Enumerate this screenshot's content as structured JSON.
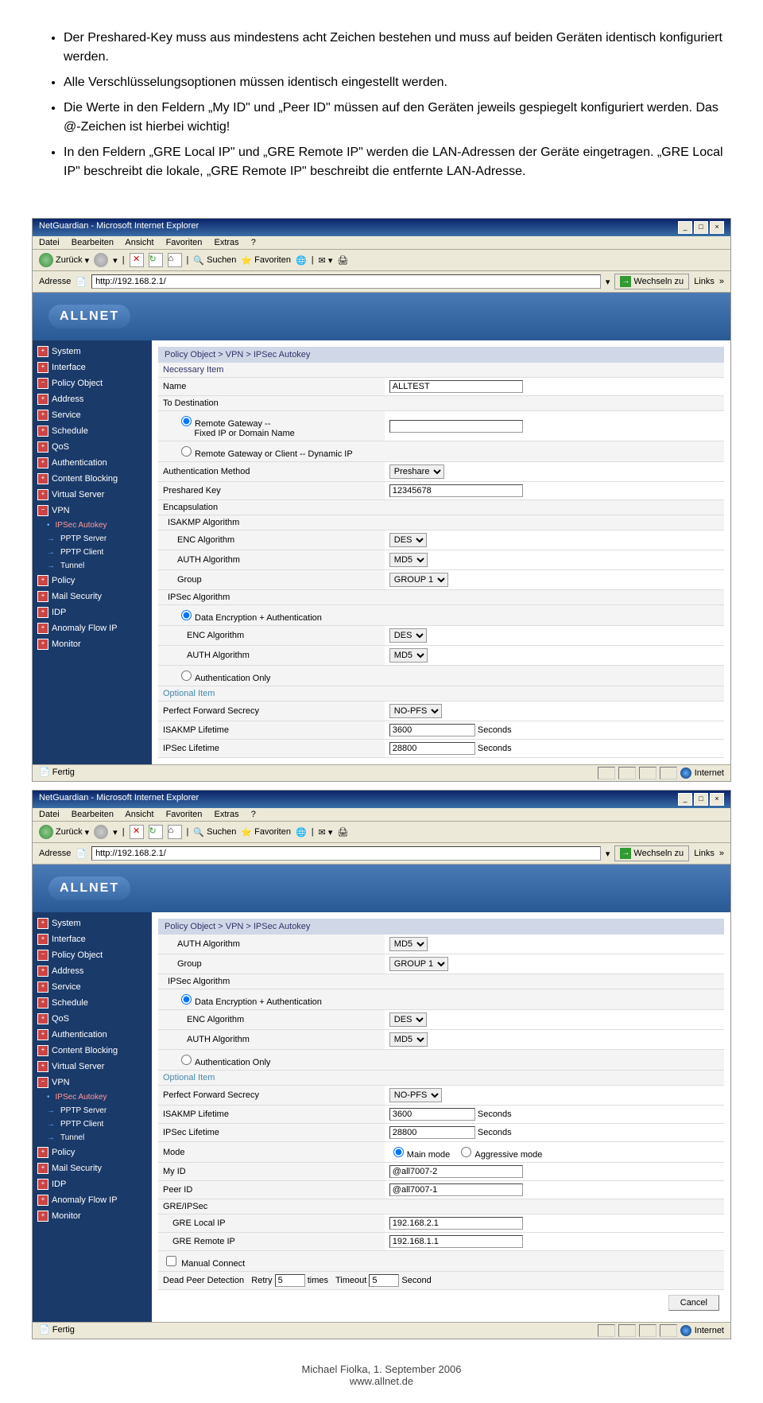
{
  "doc": {
    "bullets": [
      "Der Preshared-Key muss aus mindestens acht Zeichen bestehen und muss auf beiden Geräten identisch konfiguriert werden.",
      "Alle Verschlüsselungsoptionen müssen identisch eingestellt werden.",
      "Die Werte in den Feldern „My ID\" und „Peer ID\" müssen auf den Geräten jeweils gespiegelt konfiguriert werden. Das @-Zeichen ist hierbei wichtig!",
      "In den Feldern „GRE Local IP\" und „GRE Remote IP\" werden die LAN-Adressen der Geräte eingetragen. „GRE Local IP\" beschreibt die lokale, „GRE Remote IP\" beschreibt die entfernte LAN-Adresse."
    ]
  },
  "browser": {
    "title": "NetGuardian - Microsoft Internet Explorer",
    "menus": [
      "Datei",
      "Bearbeiten",
      "Ansicht",
      "Favoriten",
      "Extras",
      "?"
    ],
    "back": "Zurück",
    "search": "Suchen",
    "fav": "Favoriten",
    "addr_label": "Adresse",
    "url": "http://192.168.2.1/",
    "go": "Wechseln zu",
    "links": "Links",
    "status": "Fertig",
    "internet": "Internet"
  },
  "logo": "ALLNET",
  "sidebar": {
    "items": [
      "System",
      "Interface",
      "Policy Object",
      "Address",
      "Service",
      "Schedule",
      "QoS",
      "Authentication",
      "Content Blocking",
      "Virtual Server",
      "VPN"
    ],
    "vpn_sub": [
      "IPSec Autokey",
      "PPTP Server",
      "PPTP Client",
      "Tunnel"
    ],
    "items2": [
      "Policy",
      "Mail Security",
      "IDP",
      "Anomaly Flow IP",
      "Monitor"
    ]
  },
  "breadcrumb": "Policy Object > VPN > IPSec Autokey",
  "s1": {
    "necessary": "Necessary Item",
    "name_l": "Name",
    "name_v": "ALLTEST",
    "todest": "To Destination",
    "rg_fixed": "Remote Gateway --",
    "rg_fixed2": "Fixed IP or Domain Name",
    "rg_dyn": "Remote Gateway or Client -- Dynamic IP",
    "auth_method_l": "Authentication Method",
    "auth_method_v": "Preshare",
    "psk_l": "Preshared Key",
    "psk_v": "12345678",
    "encaps": "Encapsulation",
    "isakmp": "ISAKMP Algorithm",
    "enc_l": "ENC Algorithm",
    "enc_v": "DES",
    "auth_l": "AUTH Algorithm",
    "auth_v": "MD5",
    "group_l": "Group",
    "group_v": "GROUP 1",
    "ipsec": "IPSec Algorithm",
    "data_enc": "Data Encryption + Authentication",
    "auth_only": "Authentication Only",
    "optional": "Optional Item",
    "pfs_l": "Perfect Forward Secrecy",
    "pfs_v": "NO-PFS",
    "isakmp_life_l": "ISAKMP Lifetime",
    "isakmp_life_v": "3600",
    "ipsec_life_l": "IPSec Lifetime",
    "ipsec_life_v": "28800",
    "seconds": "Seconds"
  },
  "s2": {
    "mode_l": "Mode",
    "main_mode": "Main mode",
    "aggr_mode": "Aggressive mode",
    "myid_l": "My ID",
    "myid_v": "@all7007-2",
    "peerid_l": "Peer ID",
    "peerid_v": "@all7007-1",
    "gre": "GRE/IPSec",
    "gre_local_l": "GRE Local IP",
    "gre_local_v": "192.168.2.1",
    "gre_remote_l": "GRE Remote IP",
    "gre_remote_v": "192.168.1.1",
    "manual": "Manual Connect",
    "dpd": "Dead Peer Detection",
    "retry": "Retry",
    "retry_v": "5",
    "times": "times",
    "timeout": "Timeout",
    "timeout_v": "5",
    "second": "Second",
    "cancel": "Cancel"
  },
  "footer": {
    "l1": "Michael Fiolka, 1. September 2006",
    "l2": "www.allnet.de"
  }
}
